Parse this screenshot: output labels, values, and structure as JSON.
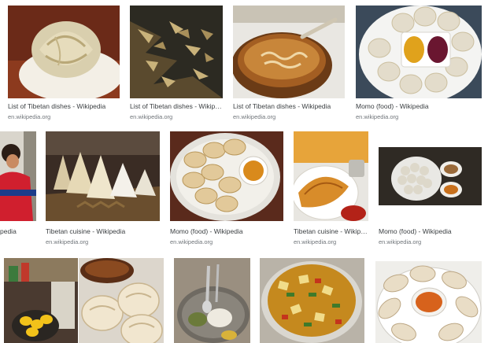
{
  "results": [
    {
      "title": "List of Tibetan dishes - Wikipedia",
      "source": "en.wikipedia.org"
    },
    {
      "title": "List of Tibetan dishes - Wikipedia",
      "source": "en.wikipedia.org"
    },
    {
      "title": "List of Tibetan dishes - Wikipedia",
      "source": "en.wikipedia.org"
    },
    {
      "title": "Momo (food) - Wikipedia",
      "source": "en.wikipedia.org"
    },
    {
      "title": "pedia",
      "source": ""
    },
    {
      "title": "Tibetan cuisine - Wikipedia",
      "source": "en.wikipedia.org"
    },
    {
      "title": "Momo (food) - Wikipedia",
      "source": "en.wikipedia.org"
    },
    {
      "title": "Tibetan cuisine - Wikipedia",
      "source": "en.wikipedia.org"
    },
    {
      "title": "Momo (food) - Wikipedia",
      "source": "en.wikipedia.org"
    }
  ],
  "row3_tiles": [
    "market-photo",
    "bread-rolls-photo",
    "plate-with-spoon-photo",
    "curry-photo",
    "momo-plate-photo"
  ]
}
